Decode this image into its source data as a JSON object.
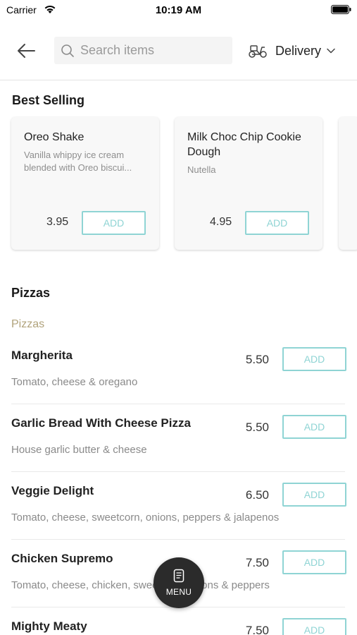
{
  "status_bar": {
    "carrier": "Carrier",
    "time": "10:19 AM"
  },
  "header": {
    "search_placeholder": "Search items",
    "delivery_label": "Delivery"
  },
  "best_selling": {
    "title": "Best Selling",
    "cards": [
      {
        "name": "Oreo Shake",
        "description": "Vanilla whippy ice cream blended with Oreo biscui...",
        "price": "3.95",
        "add_label": "ADD"
      },
      {
        "name": "Milk Choc Chip Cookie Dough",
        "description": "Nutella",
        "price": "4.95",
        "add_label": "ADD"
      }
    ]
  },
  "pizzas": {
    "title": "Pizzas",
    "subtitle": "Pizzas",
    "items": [
      {
        "name": "Margherita",
        "description": "Tomato, cheese & oregano",
        "price": "5.50",
        "add_label": "ADD"
      },
      {
        "name": "Garlic Bread With Cheese Pizza",
        "description": "House garlic butter & cheese",
        "price": "5.50",
        "add_label": "ADD"
      },
      {
        "name": "Veggie Delight",
        "description": "Tomato, cheese, sweetcorn, onions, peppers & jalapenos",
        "price": "6.50",
        "add_label": "ADD"
      },
      {
        "name": "Chicken Supremo",
        "description": "Tomato, cheese, chicken, sweetcorn, onions & peppers",
        "price": "7.50",
        "add_label": "ADD"
      },
      {
        "name": "Mighty Meaty",
        "description": "",
        "price": "7.50",
        "add_label": "ADD"
      }
    ]
  },
  "menu_button": {
    "label": "MENU"
  },
  "colors": {
    "accent_teal": "#8fd4d4",
    "subheading_gold": "#b1a37c",
    "fab_dark": "#2b2b2b"
  },
  "icons": [
    "wifi-icon",
    "battery-icon",
    "back-arrow-icon",
    "search-icon",
    "scooter-icon",
    "chevron-down-icon",
    "menu-icon"
  ]
}
